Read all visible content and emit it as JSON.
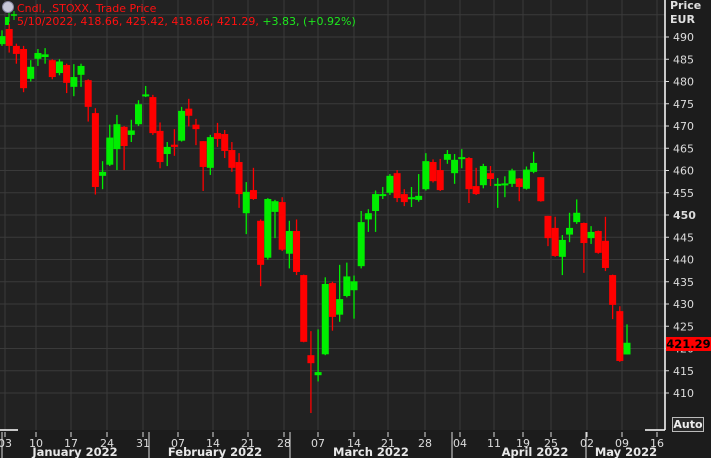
{
  "legend": {
    "title": "Cndl, .STOXX, Trade Price",
    "ohlc_text": "5/10/2022, 418.66, 425.42, 418.66, 421.29,",
    "change_text": "+3.83, (+0.92%)"
  },
  "axis": {
    "title_line1": "Price",
    "title_line2": "EUR",
    "last_price": "421.29",
    "auto_button": "Auto"
  },
  "colors": {
    "up": "#00ee00",
    "down": "#ff0000",
    "background": "#222222",
    "grid": "#3a3a3a"
  },
  "chart_data": {
    "type": "candlestick",
    "title": "Cndl, .STOXX, Trade Price",
    "ylabel": "Price EUR",
    "ylim": [
      405,
      495
    ],
    "yticks": [
      410,
      415,
      420,
      425,
      430,
      435,
      440,
      445,
      450,
      455,
      460,
      465,
      470,
      475,
      480,
      485,
      490
    ],
    "grid": true,
    "x_tick_labels": [
      "03",
      "10",
      "17",
      "24",
      "31",
      "07",
      "14",
      "21",
      "28",
      "07",
      "14",
      "21",
      "28",
      "04",
      "11",
      "19",
      "25",
      "02",
      "09",
      "16"
    ],
    "month_labels": [
      "January 2022",
      "February 2022",
      "March 2022",
      "April 2022",
      "May 2022"
    ],
    "start_date": "2022-01-03",
    "end_date": "2022-05-10",
    "candles_ohlc": [
      [
        488.4,
        491.5,
        488,
        490.2
      ],
      [
        491.8,
        493,
        486.5,
        488
      ],
      [
        488,
        488.5,
        484,
        486.2
      ],
      [
        487.3,
        488,
        477.6,
        478.5
      ],
      [
        480.6,
        484.8,
        480,
        483.3
      ],
      [
        485.1,
        487.3,
        483.5,
        486.4
      ],
      [
        485.5,
        487.5,
        484,
        486.1
      ],
      [
        484.8,
        485,
        480.5,
        481
      ],
      [
        481.9,
        485,
        481.4,
        484.5
      ],
      [
        483.7,
        484,
        477.4,
        479.7
      ],
      [
        478.8,
        483.9,
        476.7,
        481
      ],
      [
        481.5,
        484,
        478.8,
        483.5
      ],
      [
        480.3,
        480.5,
        471,
        474.3
      ],
      [
        472.9,
        474,
        454.6,
        456.3
      ],
      [
        458.8,
        462.1,
        455.8,
        459.7
      ],
      [
        461.3,
        470.3,
        461,
        467.4
      ],
      [
        464.8,
        472.5,
        460.1,
        470.4
      ],
      [
        469.8,
        470,
        460.1,
        465.5
      ],
      [
        468,
        471.4,
        466.4,
        469
      ],
      [
        470.4,
        475.8,
        470,
        474.9
      ],
      [
        476.7,
        479,
        476.5,
        477.1
      ],
      [
        476.5,
        477,
        468,
        468.4
      ],
      [
        468.9,
        470.8,
        460.5,
        461.9
      ],
      [
        463.7,
        466.4,
        461,
        465.3
      ],
      [
        465.8,
        469.3,
        463.3,
        465.3
      ],
      [
        466.7,
        474.3,
        466.5,
        473.4
      ],
      [
        473.9,
        476.1,
        469.9,
        472.3
      ],
      [
        470.3,
        471.6,
        465.7,
        469.3
      ],
      [
        466.6,
        466.6,
        455.4,
        460.8
      ],
      [
        460.6,
        468,
        459,
        467.5
      ],
      [
        468.4,
        470.7,
        465.3,
        467.1
      ],
      [
        468.2,
        469.1,
        462.8,
        464.4
      ],
      [
        464.6,
        466.4,
        459.7,
        460.6
      ],
      [
        461.9,
        463.9,
        451.6,
        454.7
      ],
      [
        450.4,
        457.4,
        445.7,
        455.2
      ],
      [
        455.6,
        460.6,
        453.4,
        453.6
      ],
      [
        448.7,
        449,
        434,
        438.8
      ],
      [
        440.4,
        453.8,
        440,
        453.6
      ],
      [
        450.7,
        453.4,
        444.8,
        453.1
      ],
      [
        452.9,
        454,
        441.9,
        442.2
      ],
      [
        441.3,
        448.7,
        438,
        446.4
      ],
      [
        446.4,
        449,
        436.5,
        437.2
      ],
      [
        436.5,
        436.6,
        421.4,
        421.5
      ],
      [
        418.5,
        423.9,
        405.5,
        416.7
      ],
      [
        414,
        424.3,
        412.6,
        414.7
      ],
      [
        418.7,
        436,
        418.5,
        434.5
      ],
      [
        434.7,
        435,
        424,
        427.1
      ],
      [
        427.6,
        438.8,
        426,
        431.1
      ],
      [
        431.8,
        439.3,
        431.5,
        436.2
      ],
      [
        433.1,
        436.4,
        426.7,
        435.1
      ],
      [
        438.5,
        450.9,
        438,
        448.4
      ],
      [
        449,
        451.3,
        446.2,
        450.4
      ],
      [
        450.9,
        455.5,
        446.2,
        454.7
      ],
      [
        454.3,
        456.3,
        453.6,
        454.7
      ],
      [
        455,
        459.2,
        454.5,
        458.8
      ],
      [
        459.4,
        460.1,
        452.9,
        453.8
      ],
      [
        454.7,
        455.8,
        452,
        452.9
      ],
      [
        453.6,
        456.3,
        451.8,
        454
      ],
      [
        453.4,
        459.2,
        453,
        454.3
      ],
      [
        455.8,
        463.9,
        455.5,
        462.1
      ],
      [
        461.9,
        462.5,
        457.3,
        457.6
      ],
      [
        460.1,
        462.6,
        455.4,
        455.6
      ],
      [
        462.4,
        464.6,
        461.5,
        463.7
      ],
      [
        459.4,
        463.7,
        457,
        462.4
      ],
      [
        462.8,
        464.8,
        460.5,
        463
      ],
      [
        462.8,
        463,
        452.7,
        455.8
      ],
      [
        456.5,
        460.6,
        454.5,
        454.7
      ],
      [
        456.7,
        461.5,
        456,
        461
      ],
      [
        459.4,
        461,
        456.5,
        458.1
      ],
      [
        456.8,
        458.3,
        451.6,
        457
      ],
      [
        456.7,
        458.7,
        454,
        457.1
      ],
      [
        457,
        460.4,
        456.3,
        460
      ],
      [
        458.2,
        458.3,
        453.1,
        456.3
      ],
      [
        455.9,
        460.9,
        455.7,
        460.2
      ],
      [
        459.7,
        464.2,
        459.4,
        461.7
      ],
      [
        458.5,
        458.5,
        453,
        453.1
      ],
      [
        449.8,
        449.8,
        443,
        444.8
      ],
      [
        447.1,
        449.6,
        440.6,
        440.8
      ],
      [
        440.6,
        445.5,
        436.5,
        444.4
      ],
      [
        445.6,
        450.5,
        443.9,
        447.1
      ],
      [
        448.4,
        453.5,
        448,
        450.5
      ],
      [
        448.2,
        448.3,
        437,
        443.7
      ],
      [
        444.8,
        447.5,
        443.5,
        446.2
      ],
      [
        446.4,
        446.5,
        441.3,
        441.5
      ],
      [
        444.2,
        449.6,
        437.4,
        438.1
      ],
      [
        436.5,
        436.6,
        426.6,
        429.8
      ],
      [
        428.4,
        429.5,
        417,
        417.2
      ],
      [
        418.66,
        425.42,
        418.66,
        421.29
      ]
    ]
  }
}
